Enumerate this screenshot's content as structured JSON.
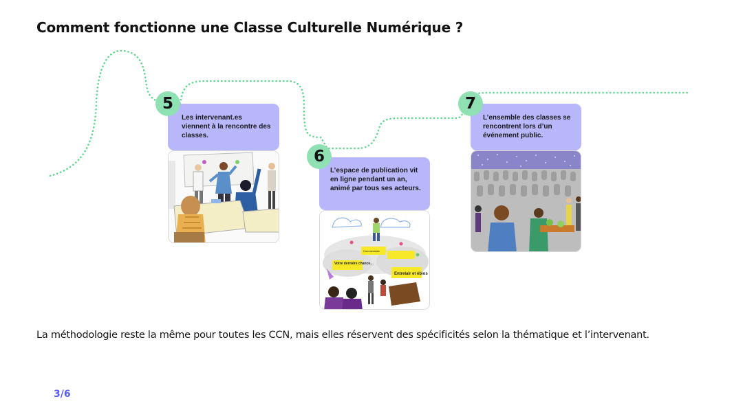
{
  "slide": {
    "title": "Comment fonctionne une Classe Culturelle Numérique ?",
    "footer_text": "La méthodologie reste la même pour toutes les CCN, mais elles réservent des spécificités selon la thématique et l’intervenant.",
    "page_indicator": "3/6"
  },
  "steps": [
    {
      "number": "5",
      "text": "Les intervenant.es viennent à la rencontre des classes.",
      "illustration": "classroom-illustration"
    },
    {
      "number": "6",
      "text": "L’espace de publication vit en ligne pendant un an, animé par tous ses acteurs.",
      "illustration": "publication-space-illustration",
      "illustration_labels": [
        "Votre dernière chance…",
        "Commentaire",
        "Entrelair et ébios"
      ]
    },
    {
      "number": "7",
      "text": "L’ensemble des classes se rencontrent lors d’un événement public.",
      "illustration": "public-event-illustration"
    }
  ],
  "colors": {
    "badge": "#8fe0b3",
    "text_box": "#b8b7fb",
    "dotted_path": "#5cd88a",
    "page_number": "#5b5bf5"
  }
}
